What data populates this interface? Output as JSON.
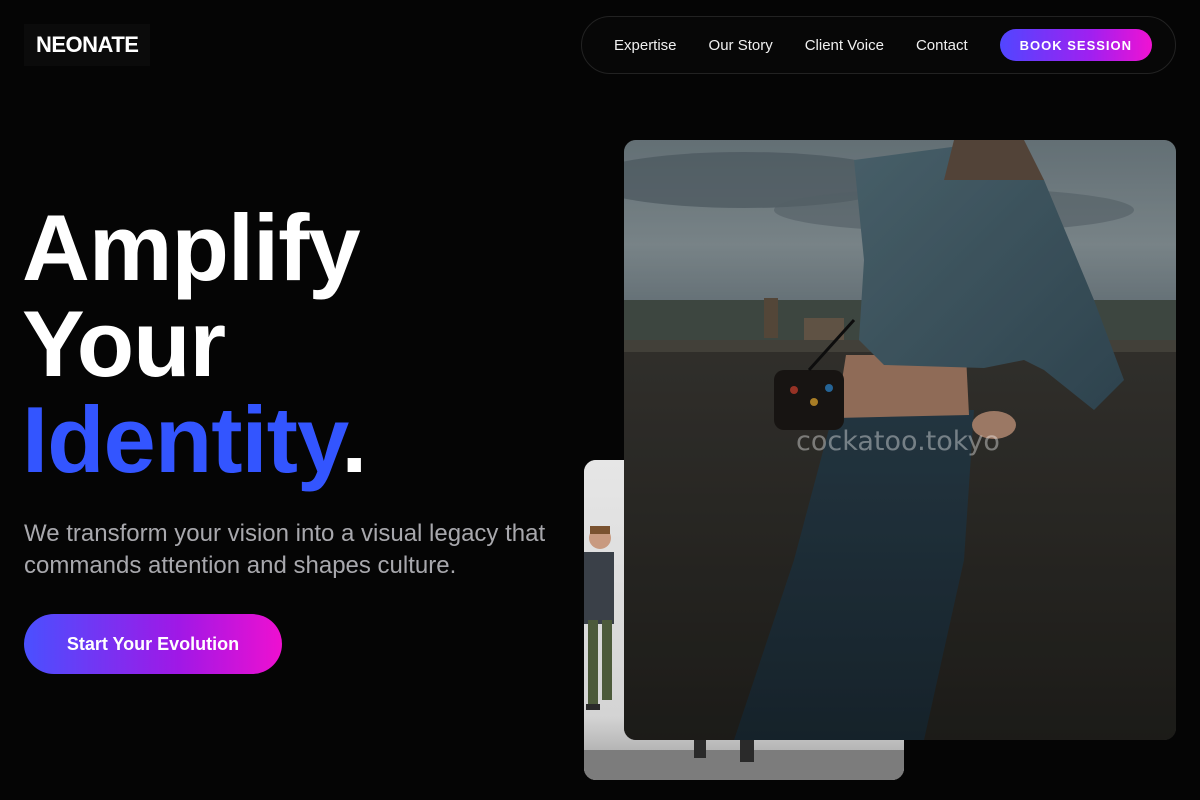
{
  "brand": {
    "logo_text": "NEONATE"
  },
  "nav": {
    "items": [
      {
        "label": "Expertise"
      },
      {
        "label": "Our Story"
      },
      {
        "label": "Client Voice"
      },
      {
        "label": "Contact"
      }
    ],
    "cta_label": "BOOK SESSION"
  },
  "hero": {
    "title_line1": "Amplify",
    "title_line2": "Your",
    "title_accent": "Identity",
    "title_dot": ".",
    "subtitle": "We transform your vision into a visual legacy that commands attention and shapes culture.",
    "cta_label": "Start Your Evolution"
  },
  "media": {
    "watermark": "cockatoo.tokyo",
    "main_photo": "photo of woman in denim jacket leaning on concrete wall",
    "secondary_photo": "photo of man walking in studio"
  },
  "colors": {
    "background": "#050505",
    "accent_blue": "#3355ff",
    "gradient_start": "#4a50ff",
    "gradient_end": "#ee10d0",
    "subtitle_gray": "#a8a8ad"
  }
}
